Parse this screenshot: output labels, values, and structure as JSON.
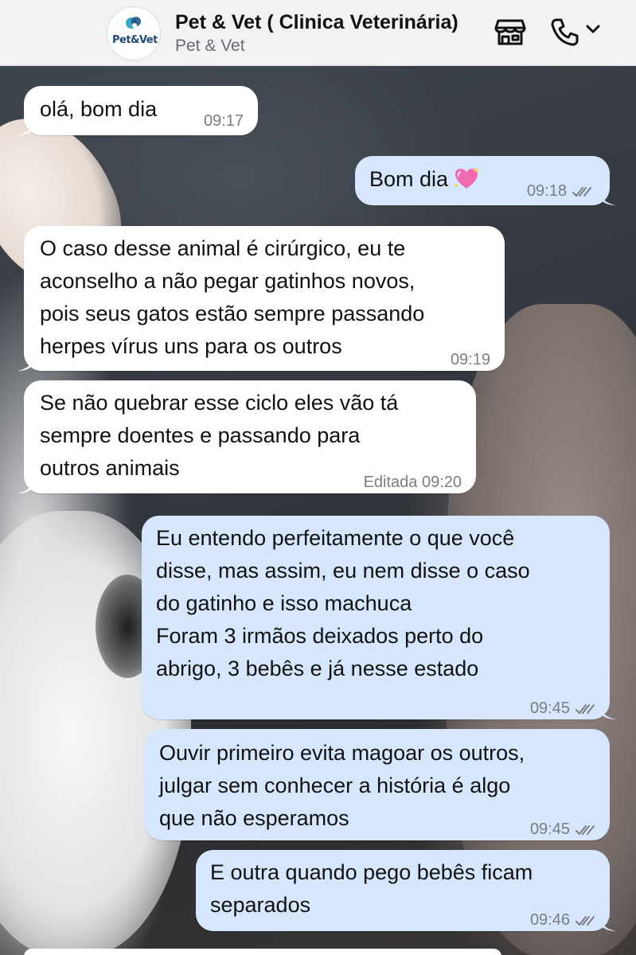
{
  "header": {
    "title": "Pet & Vet ( Clinica Veterinária)",
    "subtitle": "Pet & Vet",
    "avatar_text": "Pet&Vet",
    "icons": [
      "storefront-icon",
      "phone-icon",
      "chevron-down-icon"
    ]
  },
  "messages": [
    {
      "dir": "in",
      "lines": [
        "olá, bom dia"
      ],
      "time": "09:17"
    },
    {
      "dir": "out",
      "lines": [
        "Bom dia"
      ],
      "emoji": "sparkling-heart-emoji",
      "time": "09:18",
      "status": "read-ticks"
    },
    {
      "dir": "in",
      "lines": [
        "O caso desse animal é cirúrgico, eu te",
        "aconselho a não pegar gatinhos novos,",
        "pois seus gatos estão sempre passando",
        "herpes vírus uns para os outros"
      ],
      "time": "09:19"
    },
    {
      "dir": "in",
      "lines": [
        "Se não quebrar esse ciclo eles vão tá",
        "sempre doentes e passando para",
        "outros animais"
      ],
      "time": "Editada 09:20"
    },
    {
      "dir": "out",
      "lines": [
        "Eu entendo perfeitamente o que você",
        "disse, mas assim, eu nem disse o caso",
        "do gatinho e isso machuca",
        "Foram 3 irmãos deixados perto do",
        "abrigo, 3 bebês e já nesse estado"
      ],
      "time": "09:45",
      "status": "read-ticks"
    },
    {
      "dir": "out",
      "lines": [
        "Ouvir primeiro evita magoar os outros,",
        "julgar sem conhecer a história é algo",
        "que não esperamos"
      ],
      "time": "09:45",
      "status": "read-ticks"
    },
    {
      "dir": "out",
      "lines": [
        "E outra quando pego bebês ficam",
        "separados"
      ],
      "time": "09:46",
      "status": "read-ticks"
    }
  ],
  "colors": {
    "header_bg": "#f2f2f4",
    "incoming_bubble": "#ffffff",
    "outgoing_bubble": "#d6e7fd",
    "timestamp": "#7a7d82"
  }
}
